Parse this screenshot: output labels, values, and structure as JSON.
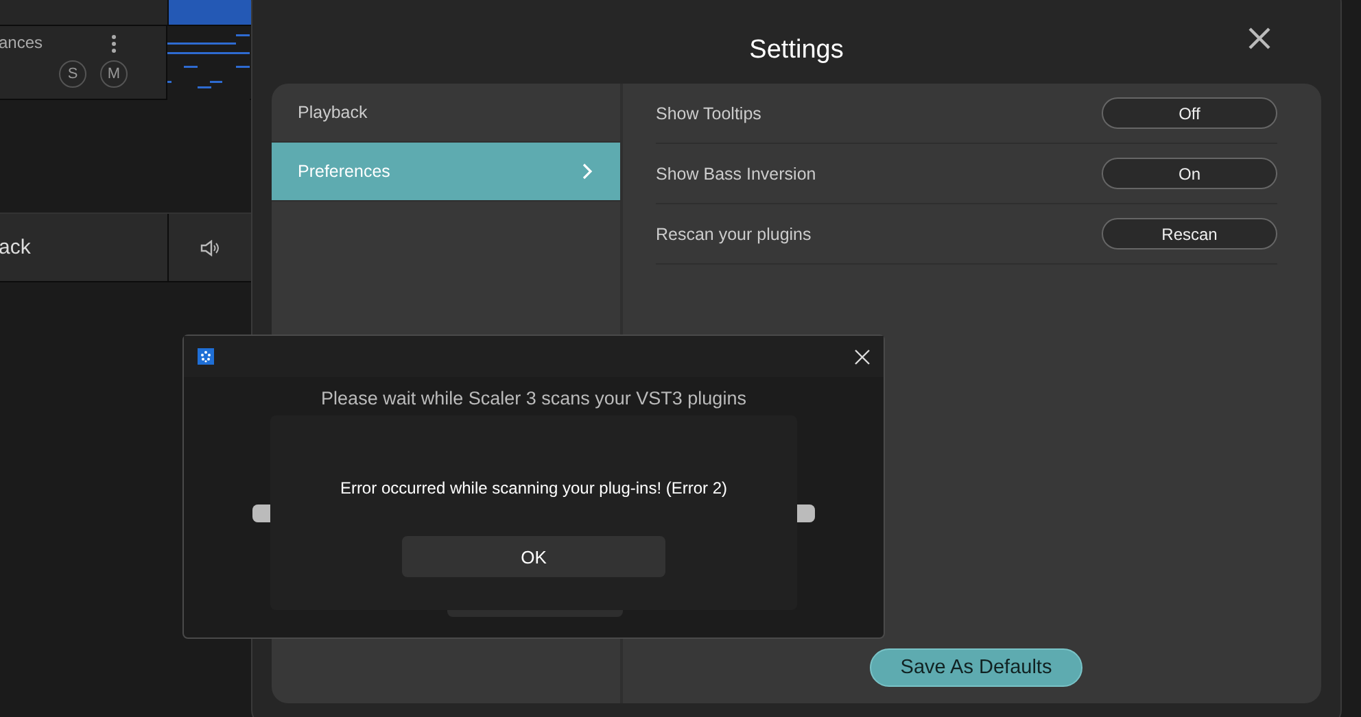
{
  "daw": {
    "tracks": [
      {
        "kind": "midi",
        "name": "ances",
        "solo": "S",
        "mute": "M"
      },
      {
        "kind": "audio",
        "name": "ack"
      }
    ]
  },
  "settings": {
    "title": "Settings",
    "sidebar": [
      {
        "label": "Playback",
        "selected": false
      },
      {
        "label": "Preferences",
        "selected": true
      }
    ],
    "options": [
      {
        "label": "Show Tooltips",
        "value": "Off"
      },
      {
        "label": "Show Bass Inversion",
        "value": "On"
      },
      {
        "label": "Rescan your plugins",
        "value": "Rescan"
      }
    ],
    "save_button": "Save As Defaults"
  },
  "scan_dialog": {
    "message": "Please wait while Scaler 3 scans your VST3 plugins",
    "progress": {
      "level": 1
    }
  },
  "error_dialog": {
    "message": "Error occurred while scanning your plug-ins! (Error 2)",
    "button": "OK"
  }
}
